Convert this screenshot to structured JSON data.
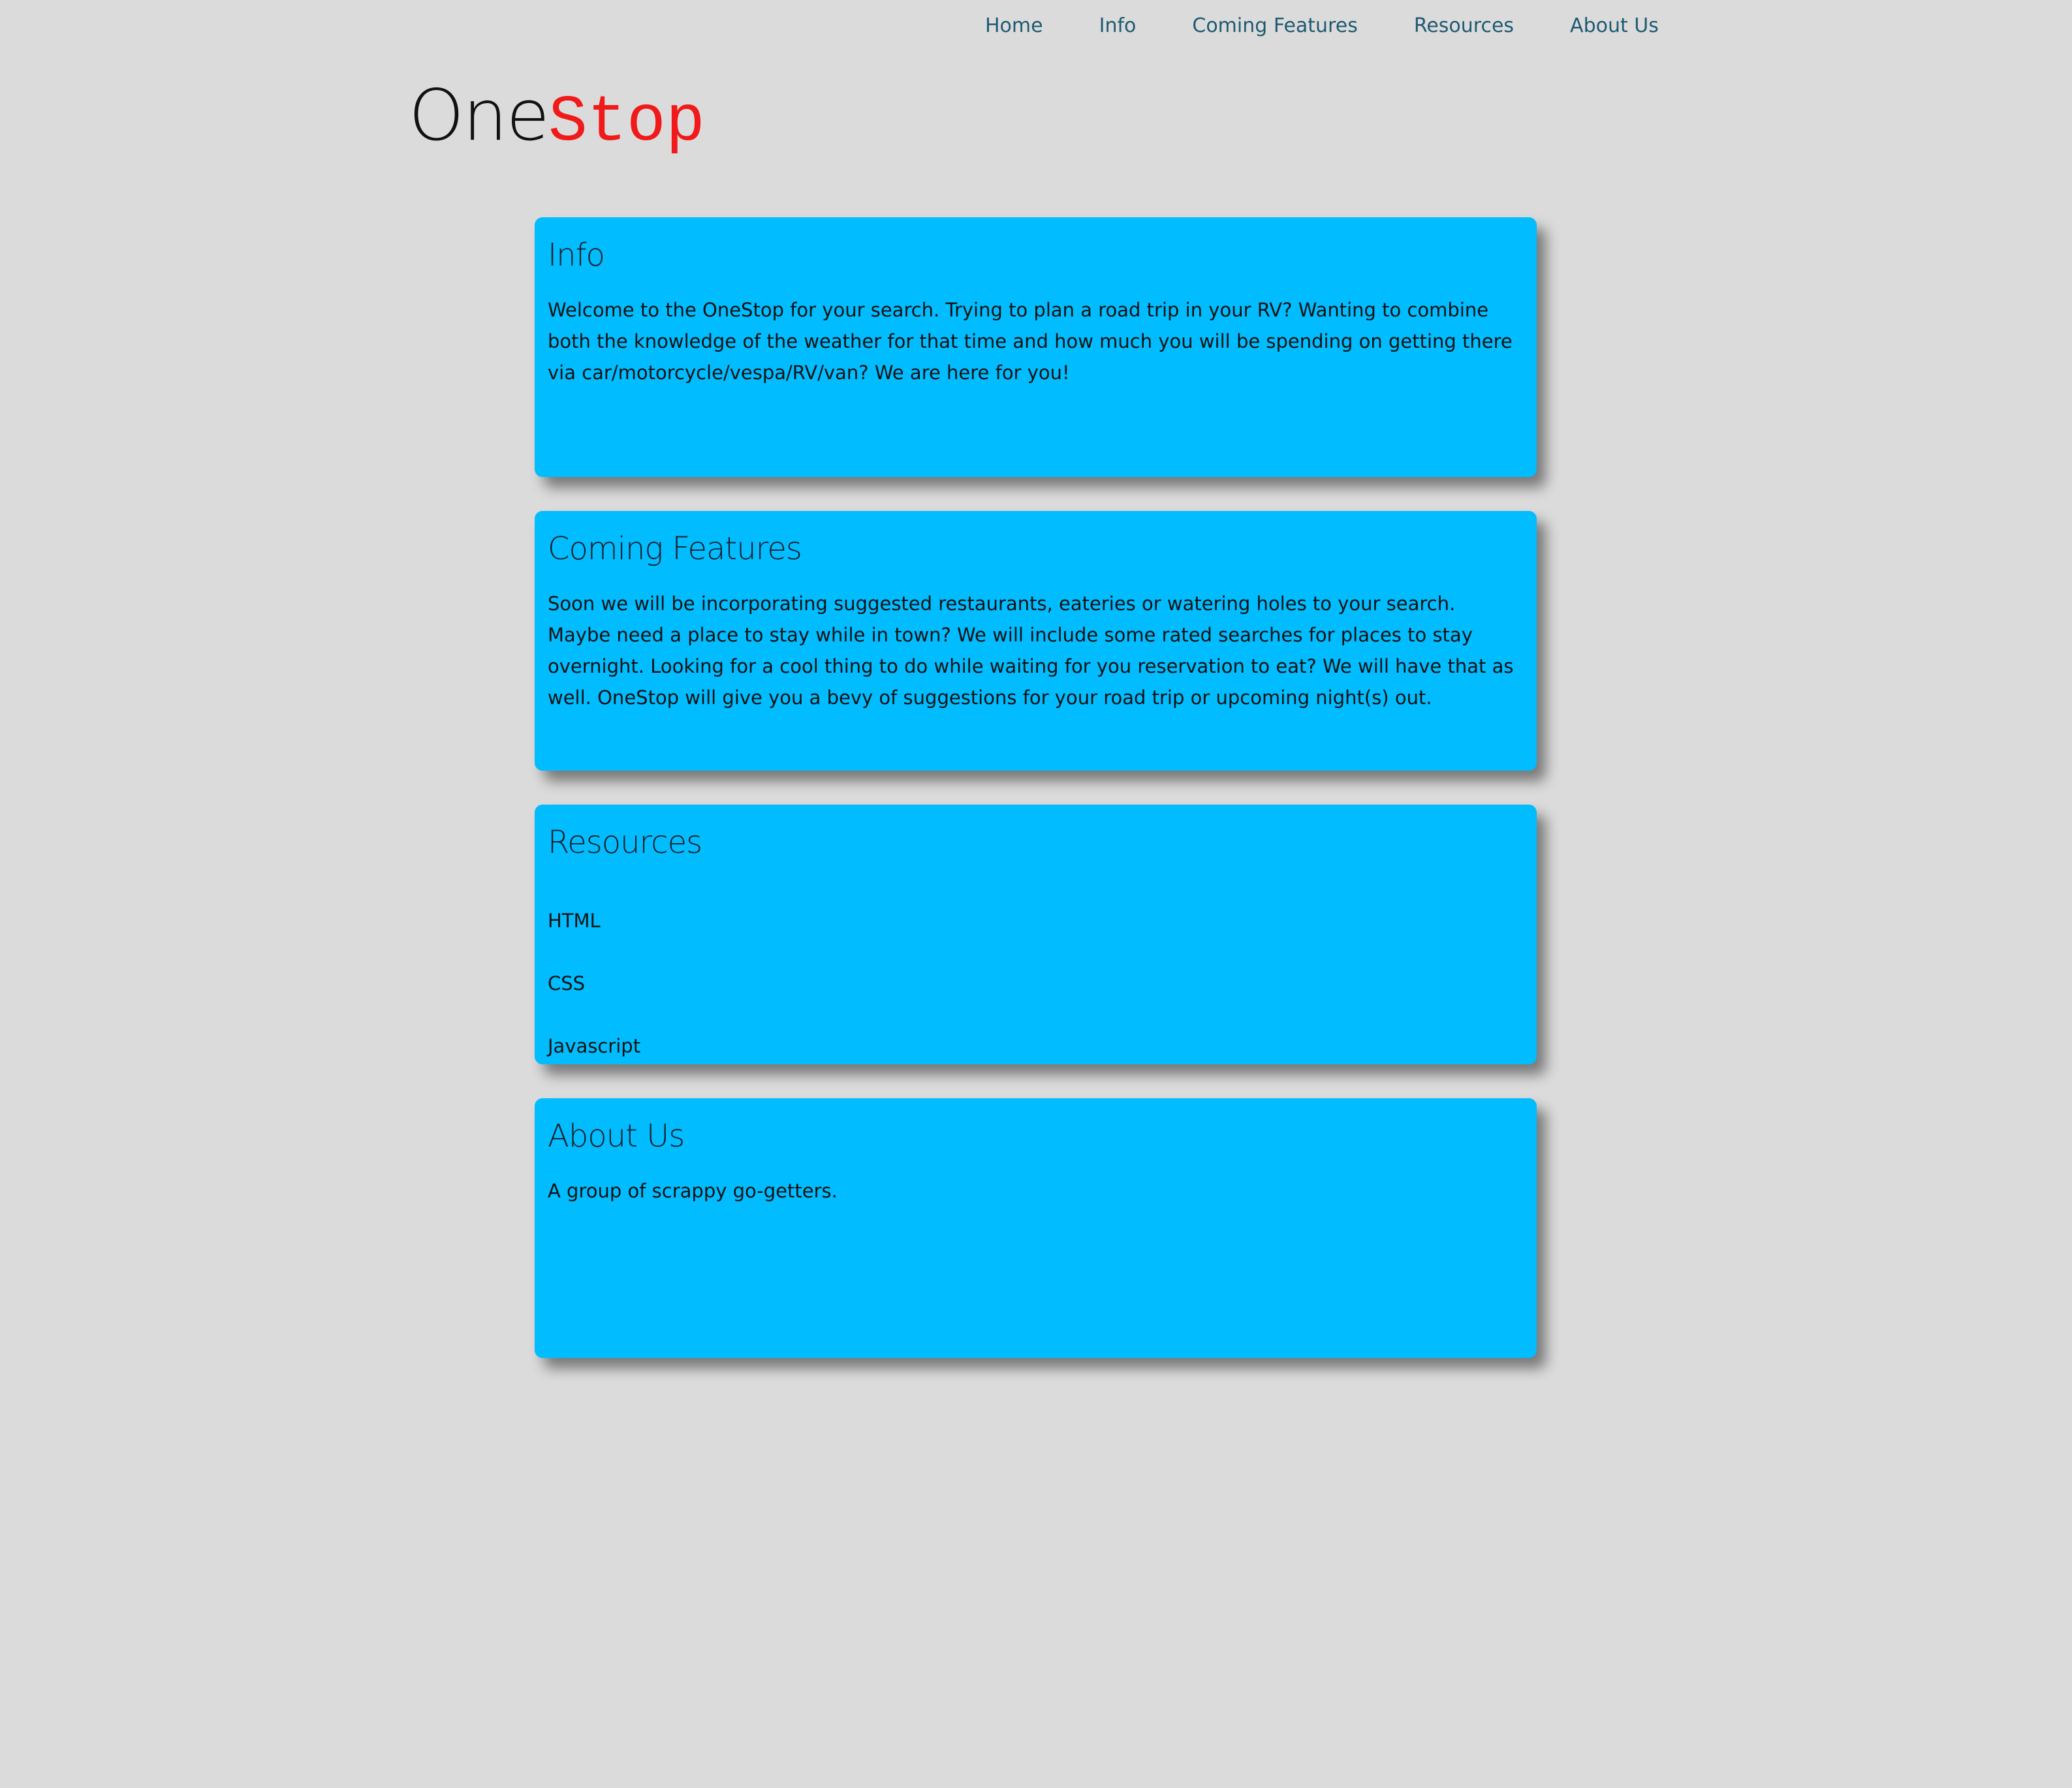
{
  "nav": {
    "items": [
      {
        "label": "Home"
      },
      {
        "label": "Info"
      },
      {
        "label": "Coming Features"
      },
      {
        "label": "Resources"
      },
      {
        "label": "About Us"
      }
    ]
  },
  "logo": {
    "part1": "One",
    "part2": "Stop"
  },
  "sections": {
    "info": {
      "title": "Info",
      "body": "Welcome to the OneStop for your search. Trying to plan a road trip in your RV? Wanting to combine both the knowledge of the weather for that time and how much you will be spending on getting there via car/motorcycle/vespa/RV/van? We are here for you!"
    },
    "coming": {
      "title": "Coming Features",
      "body": "Soon we will be incorporating suggested restaurants, eateries or watering holes to your search. Maybe need a place to stay while in town? We will include some rated searches for places to stay overnight. Looking for a cool thing to do while waiting for you reservation to eat? We will have that as well. OneStop will give you a bevy of suggestions for your road trip or upcoming night(s) out."
    },
    "resources": {
      "title": "Resources",
      "items": [
        "HTML",
        "CSS",
        "Javascript"
      ]
    },
    "about": {
      "title": "About Us",
      "body": "A group of scrappy go-getters."
    }
  },
  "colors": {
    "background": "#dcdbdb",
    "card": "#01bcff",
    "nav_link": "#1d5a72",
    "logo_accent": "#f01a1a"
  }
}
